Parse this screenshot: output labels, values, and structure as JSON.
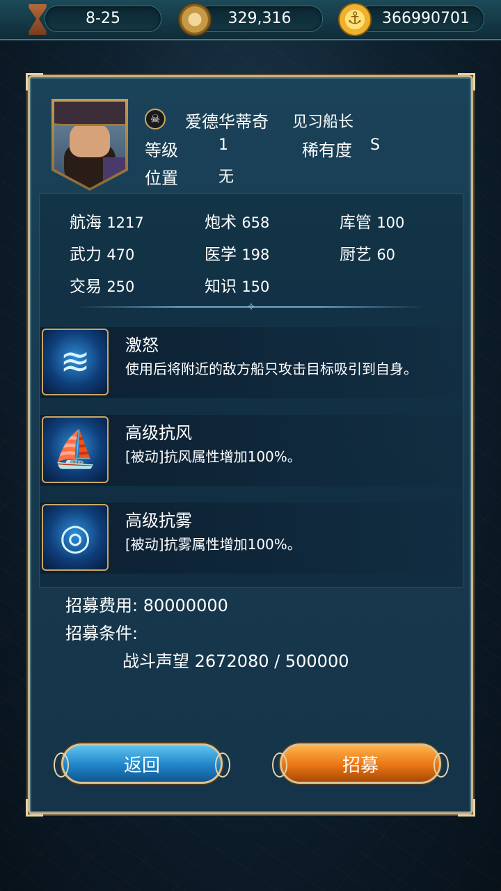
{
  "topbar": {
    "day": "8-25",
    "compass_value": "329,316",
    "gold": "366990701",
    "icons": [
      "hourglass-icon",
      "compass-icon",
      "anchor-coin-icon"
    ]
  },
  "captain": {
    "name": "爱德华蒂奇",
    "rank": "见习船长",
    "level_label": "等级",
    "level": "1",
    "rarity_label": "稀有度",
    "rarity": "S",
    "position_label": "位置",
    "position": "无"
  },
  "stats": [
    {
      "label": "航海",
      "value": "1217"
    },
    {
      "label": "炮术",
      "value": "658"
    },
    {
      "label": "库管",
      "value": "100"
    },
    {
      "label": "武力",
      "value": "470"
    },
    {
      "label": "医学",
      "value": "198"
    },
    {
      "label": "厨艺",
      "value": "60"
    },
    {
      "label": "交易",
      "value": "250"
    },
    {
      "label": "知识",
      "value": "150"
    }
  ],
  "skills": [
    {
      "name": "激怒",
      "desc": "使用后将附近的敌方船只攻击目标吸引到自身。",
      "icon": "wave-ships-icon"
    },
    {
      "name": "高级抗风",
      "desc": "[被动]抗风属性增加100%。",
      "icon": "sail-wind-icon"
    },
    {
      "name": "高级抗雾",
      "desc": "[被动]抗雾属性增加100%。",
      "icon": "fog-lantern-icon"
    }
  ],
  "recruit": {
    "cost_label": "招募费用:",
    "cost": "80000000",
    "cond_label": "招募条件:",
    "req_label": "战斗声望",
    "req_value": "2672080 / 500000"
  },
  "buttons": {
    "back": "返回",
    "recruit": "招募"
  },
  "colors": {
    "panel": "#16384d",
    "frame": "#c9b48a",
    "back_button": "#1f84c8",
    "recruit_button": "#e87514"
  }
}
